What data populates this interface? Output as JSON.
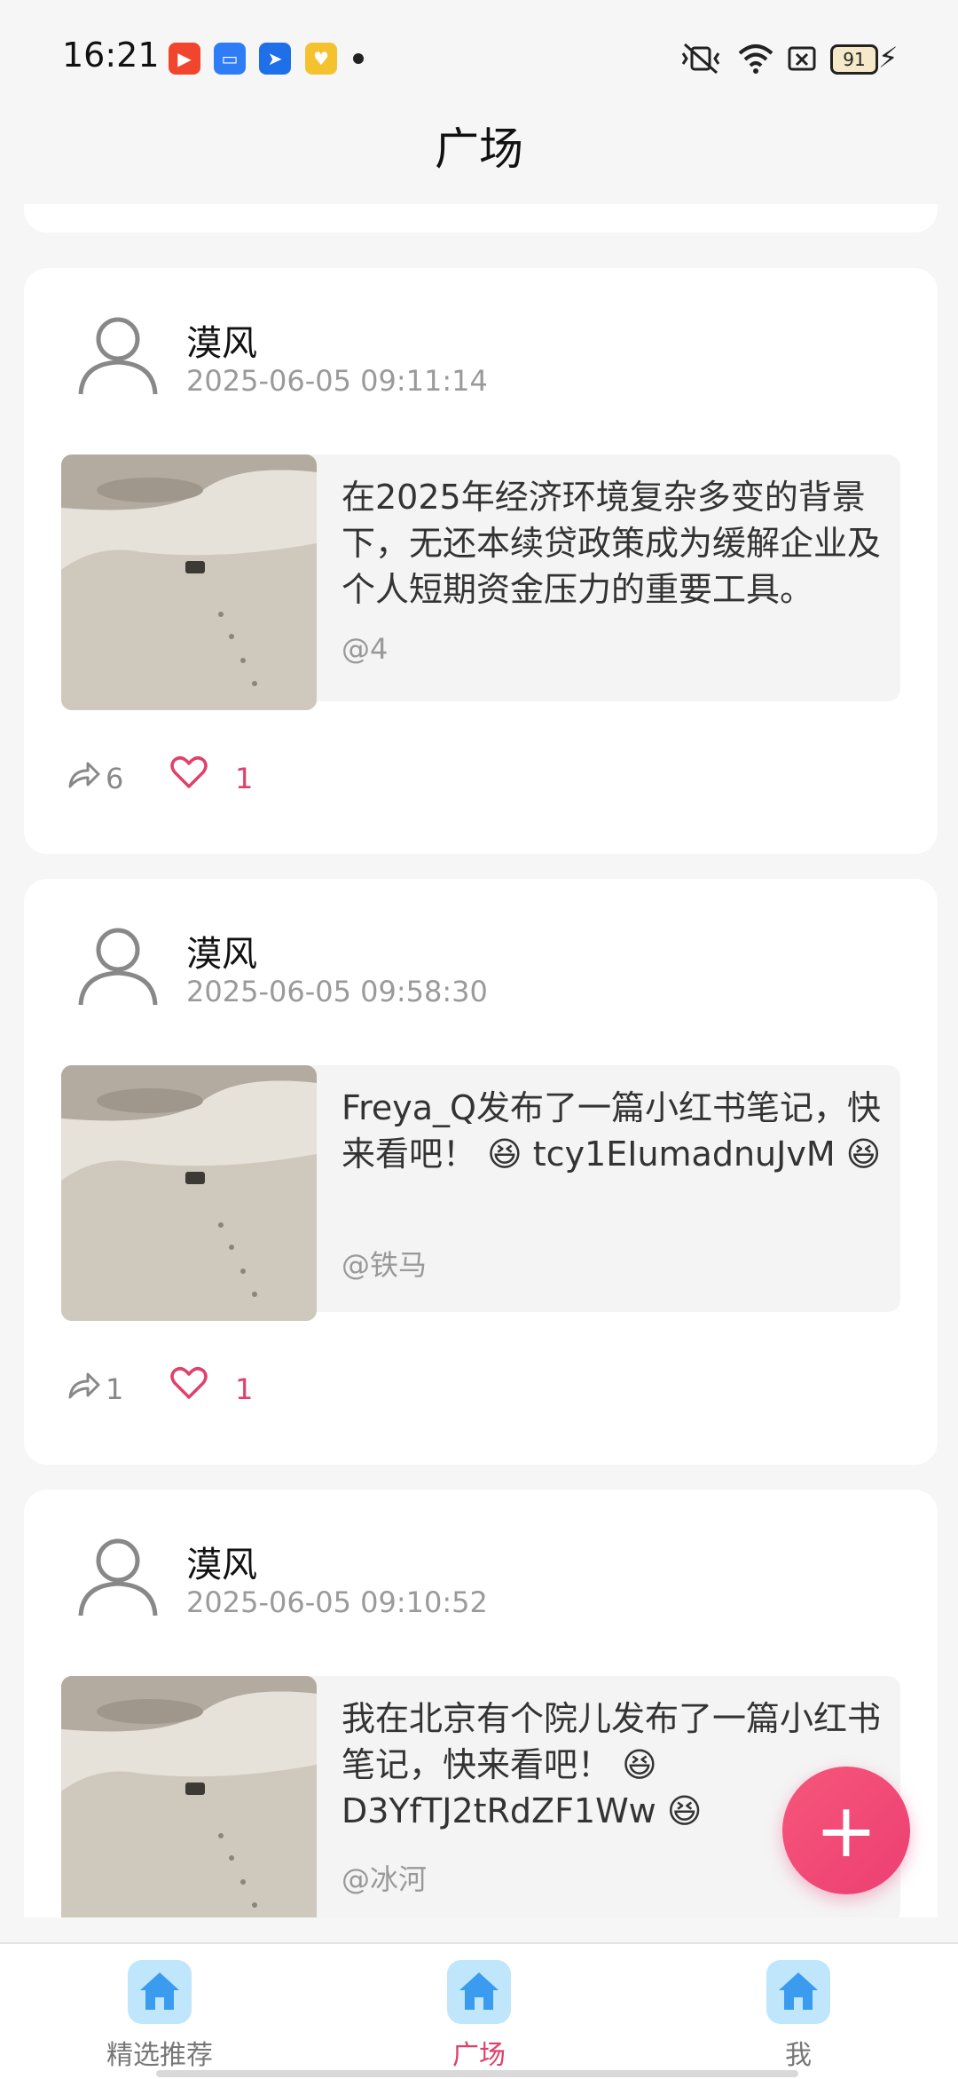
{
  "status_bar": {
    "time": "16:21",
    "battery": "91",
    "notification_icons": [
      "video-app-icon",
      "files-app-icon",
      "messaging-app-icon",
      "rewards-app-icon"
    ]
  },
  "header": {
    "title": "广场"
  },
  "posts": [
    {
      "username": "漠风",
      "timestamp": "2025-06-05 09:11:14",
      "text": "在2025年经济环境复杂多变的背景下，无还本续贷政策成为缓解企业及个人短期资金压力的重要工具。",
      "mention": "@4",
      "shares": "6",
      "likes": "1"
    },
    {
      "username": "漠风",
      "timestamp": "2025-06-05 09:58:30",
      "text": "Freya_Q发布了一篇小红书笔记，快来看吧！ 😆 tcy1EIumadnuJvM 😆",
      "mention": "@铁马",
      "shares": "1",
      "likes": "1"
    },
    {
      "username": "漠风",
      "timestamp": "2025-06-05 09:10:52",
      "text": "我在北京有个院儿发布了一篇小红书笔记，快来看吧！ 😆 D3YfTJ2tRdZF1Ww 😆",
      "mention": "@冰河",
      "shares": "",
      "likes": ""
    }
  ],
  "fab": {
    "icon": "plus-icon"
  },
  "bottom_nav": {
    "items": [
      {
        "label": "精选推荐",
        "icon": "home-icon",
        "active": false
      },
      {
        "label": "广场",
        "icon": "home-icon",
        "active": true
      },
      {
        "label": "我",
        "icon": "home-icon",
        "active": false
      }
    ]
  },
  "colors": {
    "accent": "#e0406a",
    "background": "#f6f6f6",
    "nav_icon_bg": "#bfe6fb"
  }
}
